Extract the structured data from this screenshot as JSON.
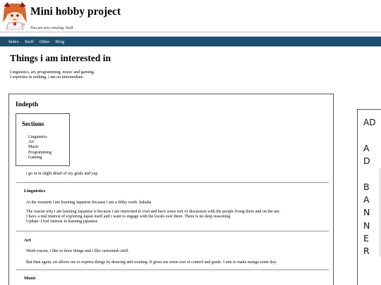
{
  "header": {
    "title": "Mini hobby project",
    "viewing": "You are now viewing: Stuff",
    "avatar_icon": "anime-girl-avatar-icon"
  },
  "nav": {
    "items": [
      "Index",
      "Stuff",
      "Other",
      "Blog"
    ]
  },
  "page": {
    "title": "Things i am interested in",
    "intro_line1": "Linguistics, art, programming, music and gaming.",
    "intro_line2": "I expertise in nothing, i am on intermediate."
  },
  "indepth": {
    "title": "Indepth",
    "sections_title": "Sections",
    "sections": [
      "Linguistics",
      "Art",
      "Music",
      "Programming",
      "Gaming"
    ],
    "goals": "i go in in slight detail of my goals and yap"
  },
  "linguistics": {
    "title": "Linguistics",
    "p1": "At the moment i am learning Japanese because i am a filthy weeb. hahaha",
    "p2_line1": "The reason why i am learning Japanese is because i am interested to visit and have some sort of discussion with the people living there and on the net.",
    "p2_line2": "I have a real interest of exploring Japan itself and i want to engage with the locals over there. There is no deep reasoning.",
    "p2_line3": "Update: I lost interest in learning japanese"
  },
  "art": {
    "title": "Art",
    "p1": "Weeb reason, i like to draw things and i like cartoonish stuff.",
    "p2": "But then again, art allows me to express things by drawing and creating. It gives me some sort of control and guide. I aim to make manga some day."
  },
  "music": {
    "title": "Music"
  },
  "ad": {
    "top": "AD",
    "vertical": [
      "A",
      "D",
      "",
      "B",
      "A",
      "N",
      "N",
      "E",
      "R"
    ]
  },
  "colors": {
    "nav_bg": "#1d4d6e",
    "nav_text": "#ffffff"
  }
}
